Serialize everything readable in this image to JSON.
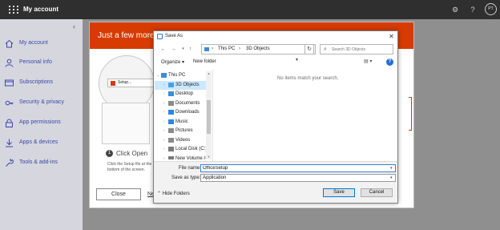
{
  "header": {
    "app_title": "My account",
    "avatar_initials": "PT"
  },
  "sidebar": {
    "items": [
      {
        "label": "My account",
        "icon": "home-icon"
      },
      {
        "label": "Personal info",
        "icon": "person-icon"
      },
      {
        "label": "Subscriptions",
        "icon": "card-icon"
      },
      {
        "label": "Security & privacy",
        "icon": "key-icon"
      },
      {
        "label": "App permissions",
        "icon": "lock-icon"
      },
      {
        "label": "Apps & devices",
        "icon": "download-icon"
      },
      {
        "label": "Tools & add-ins",
        "icon": "wrench-icon"
      }
    ]
  },
  "install_panel": {
    "title": "Just a few more s",
    "circle_button_label": "Setup...",
    "step_number": "1",
    "step_title": "Click Open",
    "step_desc": "Click the Setup file at the bottom of the screen.",
    "close_label": "Close",
    "link_label": "Ne"
  },
  "dialog": {
    "title": "Save As",
    "path": [
      "This PC",
      "3D Objects"
    ],
    "search_placeholder": "Search 3D Objects",
    "toolbar": {
      "organize": "Organize ▾",
      "new_folder": "New folder"
    },
    "tree": [
      {
        "label": "This PC",
        "indent": 0,
        "selected": false,
        "icon_color": "#3b8ed8"
      },
      {
        "label": "3D Objects",
        "indent": 1,
        "selected": true,
        "icon_color": "#4aa0e6"
      },
      {
        "label": "Desktop",
        "indent": 1,
        "selected": false,
        "icon_color": "#3b8ed8"
      },
      {
        "label": "Documents",
        "indent": 1,
        "selected": false,
        "icon_color": "#8a8a8a"
      },
      {
        "label": "Downloads",
        "indent": 1,
        "selected": false,
        "icon_color": "#2e86de"
      },
      {
        "label": "Music",
        "indent": 1,
        "selected": false,
        "icon_color": "#2e86de"
      },
      {
        "label": "Pictures",
        "indent": 1,
        "selected": false,
        "icon_color": "#8a8a8a"
      },
      {
        "label": "Videos",
        "indent": 1,
        "selected": false,
        "icon_color": "#8a8a8a"
      },
      {
        "label": "Local Disk (C:)",
        "indent": 1,
        "selected": false,
        "icon_color": "#7a7a7a"
      },
      {
        "label": "New Volume (G",
        "indent": 1,
        "selected": false,
        "icon_color": "#7a7a7a"
      }
    ],
    "empty_message": "No items match your search.",
    "file_name_label": "File name:",
    "file_name_value": "OfficeSetup",
    "save_type_label": "Save as type:",
    "save_type_value": "Application",
    "hide_folders": "Hide Folders",
    "save_label": "Save",
    "cancel_label": "Cancel"
  },
  "colors": {
    "accent_orange": "#d83b01",
    "link_blue": "#3b49a8",
    "selection": "#cce8ff"
  }
}
